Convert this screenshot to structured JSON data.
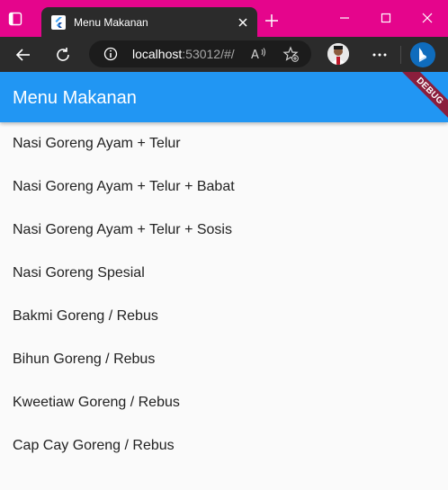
{
  "tab": {
    "title": "Menu Makanan"
  },
  "address": {
    "host": "localhost",
    "rest": ":53012/#/"
  },
  "app": {
    "title": "Menu Makanan",
    "debug_label": "DEBUG"
  },
  "menu": [
    "Nasi Goreng Ayam + Telur",
    "Nasi Goreng Ayam + Telur + Babat",
    "Nasi Goreng Ayam + Telur + Sosis",
    "Nasi Goreng Spesial",
    "Bakmi Goreng / Rebus",
    "Bihun Goreng / Rebus",
    "Kweetiaw Goreng / Rebus",
    "Cap Cay Goreng / Rebus"
  ],
  "colors": {
    "titlebar": "#e5058c",
    "toolbar": "#2b2b2b",
    "appbar": "#2196f3",
    "page": "#fafafa",
    "debug_banner": "#8b1e3c"
  }
}
